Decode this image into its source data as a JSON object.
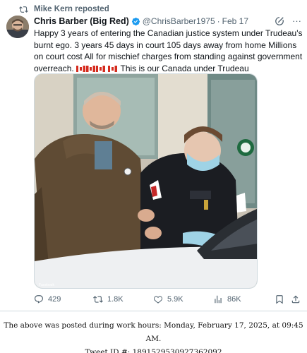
{
  "repost": {
    "label": "Mike Kern reposted",
    "icon": "repost-icon"
  },
  "author": {
    "display_name": "Chris Barber (Big Red)",
    "handle": "@ChrisBarber1975",
    "separator": "·",
    "date": "Feb 17",
    "verified_color": "#1d9bf0"
  },
  "tweet": {
    "line_1": "Happy 3 years of entering the Canadian justice system under Trudeau's burnt ego. 3 years 45 days in court 105 days away from home Millions on court cost All for mischief charges from standing against government overreach.",
    "line_2": "This is our Canada under Trudeau"
  },
  "media": {
    "watermark": "Facebook"
  },
  "actions": {
    "replies": "429",
    "reposts": "1.8K",
    "likes": "5.9K",
    "views": "86K"
  },
  "caption": {
    "line_1": "The above was posted during work hours: Monday, February 17, 2025, at 09:45 AM.",
    "line_2": "Tweet ID #: 1891529530927362092"
  },
  "colors": {
    "secondary_text": "#536471",
    "border": "#cfd9de",
    "accent": "#1d9bf0"
  }
}
